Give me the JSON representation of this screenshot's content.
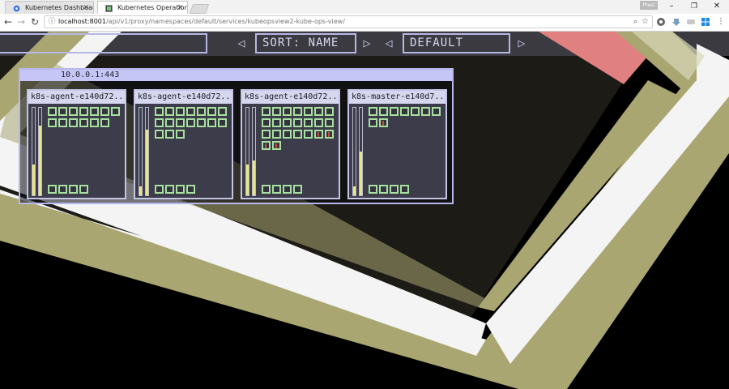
{
  "browser": {
    "tabs": [
      {
        "title": "Kubernetes Dashboard",
        "active": false,
        "favicon": "kubernetes-icon"
      },
      {
        "title": "Kubernetes Operational",
        "active": true,
        "favicon": "kube-ops-view-icon"
      }
    ],
    "profile_label": "Ptest",
    "window_controls": {
      "minimize": "–",
      "maximize": "❐",
      "close": "✕"
    },
    "nav": {
      "back": "←",
      "forward": "→",
      "reload": "↻"
    },
    "url_host": "localhost:8001",
    "url_path": "/api/v1/proxy/namespaces/default/services/kubeopsview2-kube-ops-view/",
    "zoom_icon": "⌕",
    "bookmark_icon": "☆",
    "extension_icons": [
      "extension-icon",
      "download-icon",
      "extension-icon-2",
      "windows-icon",
      "menu-icon"
    ]
  },
  "app": {
    "colors": {
      "accent": "#b7b7e6",
      "pod_ok": "#a8e0a0",
      "pod_error": "#ad4a48",
      "node_bg": "#3c3c4a",
      "stripe_olive": "#a9a672",
      "stripe_white": "#f4f4f4",
      "stripe_red": "#e08080"
    },
    "filter_value": "",
    "sort_prev_icon": "◁",
    "sort_label": "SORT: NAME",
    "sort_next_icon": "▷",
    "theme_prev_icon": "◁",
    "theme_label": "DEFAULT",
    "theme_next_icon": "▷",
    "cluster": {
      "label": "10.0.0.1:443",
      "nodes": [
        {
          "name": "k8s-agent-e140d72...",
          "cpu": 0.35,
          "memory": 0.8,
          "pods": 13,
          "error_pods": 0
        },
        {
          "name": "k8s-agent-e140d72...",
          "cpu": 0.1,
          "memory": 0.75,
          "pods": 17,
          "error_pods": 0
        },
        {
          "name": "k8s-agent-e140d72...",
          "cpu": 0.35,
          "memory": 0.4,
          "pods": 23,
          "error_pods": 4
        },
        {
          "name": "k8s-master-e140d7...",
          "cpu": 0.1,
          "memory": 0.5,
          "pods": 9,
          "error_pods": 1
        }
      ]
    }
  }
}
